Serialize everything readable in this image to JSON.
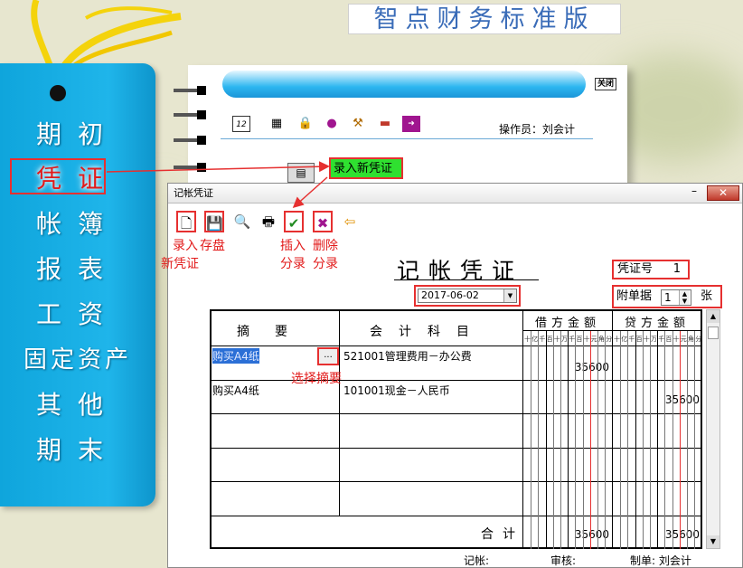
{
  "app_title": "智点财务标准版",
  "sidebar": {
    "items": [
      {
        "label": "期初"
      },
      {
        "label": "凭证",
        "active": true
      },
      {
        "label": "帐簿"
      },
      {
        "label": "报表"
      },
      {
        "label": "工资"
      },
      {
        "label": "固定资产"
      },
      {
        "label": "其他"
      },
      {
        "label": "期末"
      }
    ]
  },
  "back_panel": {
    "close_label": "关闭",
    "operator_text": "操作员：刘会计",
    "new_voucher_label": "录入新凭证"
  },
  "voucher_window": {
    "title": "记帐凭证",
    "close_glyph": "✕",
    "minimize_glyph": "–",
    "tool_labels": {
      "new_line1": "录入",
      "new_line2": "新凭证",
      "save": "存盘",
      "insert_line1": "插入",
      "insert_line2": "分录",
      "delete_line1": "删除",
      "delete_line2": "分录"
    },
    "heading": "记帐凭证",
    "voucher_no_label": "凭证号",
    "voucher_no": "1",
    "date": "2017-06-02",
    "attachments_label": "附单据",
    "attachments_count": "1",
    "attachments_unit": "张",
    "columns": {
      "summary": "摘　　要",
      "account": "会　计　科　目",
      "debit": "借方金额",
      "credit": "贷方金额",
      "digits": [
        "十",
        "亿",
        "千",
        "百",
        "十",
        "万",
        "千",
        "百",
        "十",
        "元",
        "角",
        "分"
      ]
    },
    "pick_summary_label": "选择摘要",
    "ellipsis": "...",
    "rows": [
      {
        "summary": "购买A4纸",
        "account": "521001管理费用－办公费",
        "debit": "35600",
        "credit": ""
      },
      {
        "summary": "购买A4纸",
        "account": "101001现金－人民币",
        "debit": "",
        "credit": "35600"
      }
    ],
    "total_label": "合计",
    "total_debit": "35600",
    "total_credit": "35600",
    "footer": {
      "bookkeeper": "记帐:",
      "reviewer": "审核:",
      "preparer": "制单: 刘会计"
    }
  }
}
